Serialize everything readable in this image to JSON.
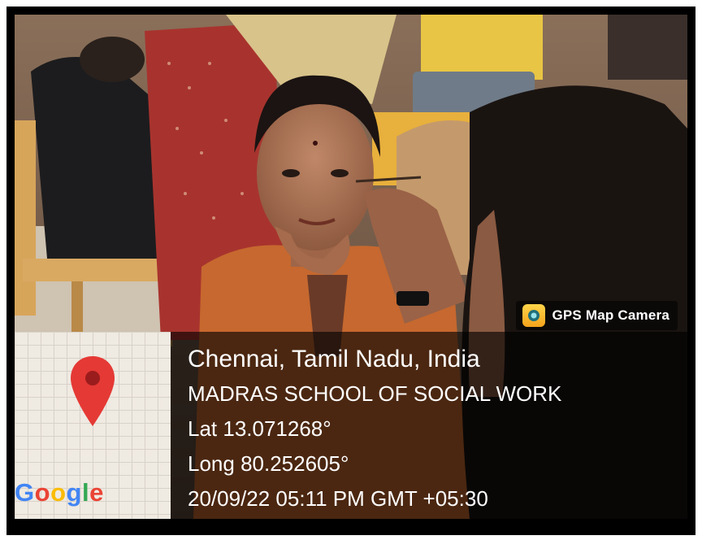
{
  "watermark": {
    "label": "GPS Map Camera",
    "icon": "camera-pin-icon"
  },
  "map": {
    "pin_icon": "map-pin-icon",
    "logo_letters": [
      "G",
      "o",
      "o",
      "g",
      "l",
      "e"
    ],
    "logo_colors": [
      "#4285F4",
      "#EA4335",
      "#FBBC05",
      "#4285F4",
      "#34A853",
      "#EA4335"
    ]
  },
  "location": {
    "city": "Chennai, Tamil Nadu, India",
    "place": "MADRAS SCHOOL OF SOCIAL WORK",
    "latitude": "Lat 13.071268°",
    "longitude": "Long 80.252605°",
    "timestamp": "20/09/22 05:11 PM GMT +05:30"
  },
  "colors": {
    "pin": "#e53935",
    "pin_dot": "#b71c1c",
    "overlay_text": "#ffffff"
  }
}
